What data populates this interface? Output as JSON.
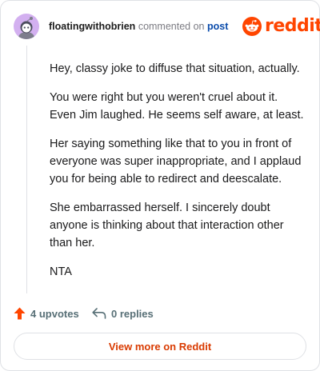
{
  "header": {
    "author": "floatingwithobrien",
    "action": "commented on",
    "post_link": "post",
    "brand": "reddit"
  },
  "comment": {
    "paragraphs": [
      "Hey, classy joke to diffuse that situation, actually.",
      "You were right but you weren't cruel about it. Even Jim laughed. He seems self aware, at least.",
      "Her saying something like that to you in front of everyone was super inappropriate, and I applaud you for being able to redirect and deescalate.",
      "She embarrassed herself. I sincerely doubt anyone is thinking about that interaction other than her.",
      "NTA"
    ]
  },
  "footer": {
    "upvotes": "4 upvotes",
    "replies": "0 replies"
  },
  "cta": {
    "label": "View more on Reddit"
  },
  "icons": {
    "avatar": "snoo-avatar-icon",
    "logo": "reddit-logo-icon",
    "upvote": "upvote-arrow-icon",
    "reply": "reply-arrow-icon"
  },
  "colors": {
    "brand": "#ff4500",
    "upvote": "#ff4500",
    "link": "#0a4bab",
    "cta_text": "#d93a00",
    "avatar_bg": "#d3b0f0"
  }
}
